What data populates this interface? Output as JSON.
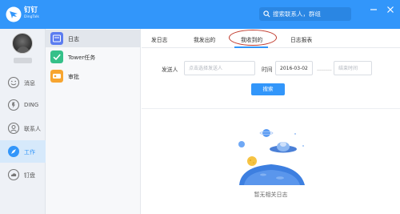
{
  "app": {
    "brand_cn": "钉钉",
    "brand_en": "DingTalk",
    "accent": "#3296fa",
    "annotation_color": "#c0392b"
  },
  "search": {
    "placeholder": "搜索联系人，群组"
  },
  "nav": {
    "items": [
      {
        "label": "消息",
        "icon": "smile-icon",
        "active": false
      },
      {
        "label": "DING",
        "icon": "ding-icon",
        "active": false
      },
      {
        "label": "联系人",
        "icon": "contacts-icon",
        "active": false
      },
      {
        "label": "工作",
        "icon": "work-icon",
        "active": true
      },
      {
        "label": "钉盘",
        "icon": "cloud-disk-icon",
        "active": false
      }
    ]
  },
  "apps": {
    "items": [
      {
        "label": "日志",
        "icon": "journal-icon",
        "color": "#5b7cf0",
        "active": true
      },
      {
        "label": "Tower任务",
        "icon": "tower-task-icon",
        "color": "#35c089",
        "active": false
      },
      {
        "label": "审批",
        "icon": "approval-icon",
        "color": "#f7a530",
        "active": false
      }
    ]
  },
  "tabs": {
    "items": [
      {
        "label": "发日志"
      },
      {
        "label": "我发出的"
      },
      {
        "label": "我收到的"
      },
      {
        "label": "日志报表"
      }
    ],
    "active_index": 2
  },
  "filter": {
    "sender_label": "发送人",
    "sender_placeholder": "点击选择发送人",
    "time_label": "时间",
    "start_date": "2016-03-02",
    "end_placeholder": "结束时间",
    "search_button": "搜索"
  },
  "empty": {
    "text": "暂无相关日志"
  }
}
